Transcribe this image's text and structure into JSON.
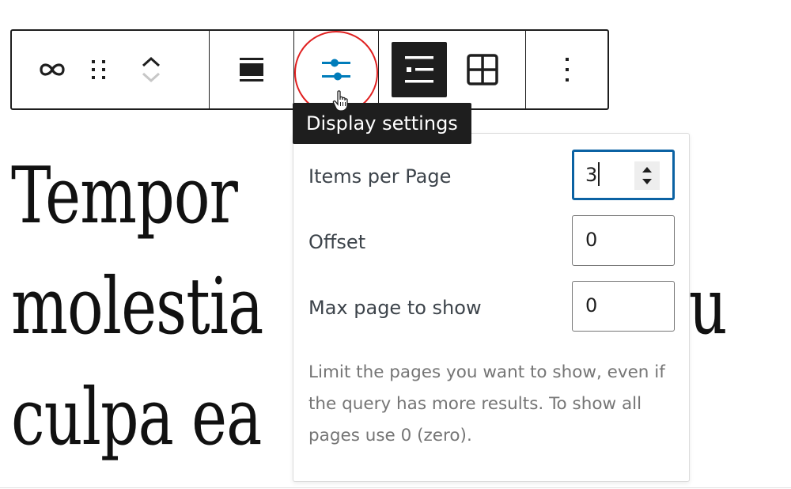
{
  "heading": {
    "line1": "Tempor",
    "line2": "molestia                    atu",
    "line3": "culpa ea"
  },
  "toolbar": {
    "buttons": [
      {
        "name": "link-icon"
      },
      {
        "name": "drag-handle-icon"
      },
      {
        "name": "move-up-icon"
      },
      {
        "name": "move-down-icon"
      },
      {
        "name": "align-icon"
      },
      {
        "name": "settings-sliders-icon"
      },
      {
        "name": "list-view-icon",
        "active": true
      },
      {
        "name": "grid-view-icon"
      },
      {
        "name": "more-options-icon"
      }
    ]
  },
  "tooltip": {
    "text": "Display settings"
  },
  "popover": {
    "fields": {
      "items_per_page": {
        "label": "Items per Page",
        "value": "3"
      },
      "offset": {
        "label": "Offset",
        "value": "0"
      },
      "max_page": {
        "label": "Max page to show",
        "value": "0"
      }
    },
    "help_text": "Limit the pages you want to show, even if the query has more results. To show all pages use 0 (zero)."
  },
  "colors": {
    "accent": "#007cba",
    "focus_border": "#0b62a3",
    "highlight_circle": "#e02020",
    "dark": "#1e1e1e"
  }
}
